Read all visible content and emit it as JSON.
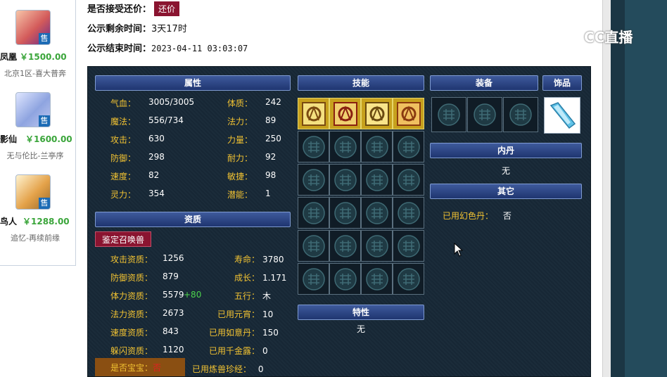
{
  "sidebar": {
    "pets": [
      {
        "name": "凤凰",
        "price": "￥1500.00",
        "server": "北京1区-喜大普奔",
        "sold_label": "售"
      },
      {
        "name": "影仙",
        "price": "￥1600.00",
        "server": "无与伦比-兰亭序",
        "sold_label": "售"
      },
      {
        "name": "鸟人",
        "price": "￥1288.00",
        "server": "追忆-再续前缘",
        "sold_label": "售"
      }
    ]
  },
  "listing": {
    "bargain_label": "是否接受还价：",
    "bargain_button": "还价",
    "remaining_label": "公示剩余时间：",
    "remaining_value": "3天17时",
    "end_label": "公示结束时间：",
    "end_value": "2023-04-11 03:03:07"
  },
  "watermark": {
    "text": "CC直播"
  },
  "attributes": {
    "header": "属性",
    "left": [
      {
        "k": "气血：",
        "v": "3005/3005"
      },
      {
        "k": "魔法：",
        "v": "556/734"
      },
      {
        "k": "攻击：",
        "v": "630"
      },
      {
        "k": "防御：",
        "v": "298"
      },
      {
        "k": "速度：",
        "v": "82"
      },
      {
        "k": "灵力：",
        "v": "354"
      }
    ],
    "right": [
      {
        "k": "体质：",
        "v": "242"
      },
      {
        "k": "法力：",
        "v": "89"
      },
      {
        "k": "力量：",
        "v": "250"
      },
      {
        "k": "耐力：",
        "v": "92"
      },
      {
        "k": "敏捷：",
        "v": "98"
      },
      {
        "k": "潜能：",
        "v": "1"
      }
    ]
  },
  "aptitude": {
    "header": "资质",
    "appraise_button": "鉴定召唤兽",
    "left": [
      {
        "k": "攻击资质：",
        "v": "1256",
        "plus": ""
      },
      {
        "k": "防御资质：",
        "v": "879",
        "plus": ""
      },
      {
        "k": "体力资质：",
        "v": "5579",
        "plus": "+80"
      },
      {
        "k": "法力资质：",
        "v": "2673",
        "plus": ""
      },
      {
        "k": "速度资质：",
        "v": "843",
        "plus": ""
      },
      {
        "k": "躲闪资质：",
        "v": "1120",
        "plus": ""
      }
    ],
    "right": [
      {
        "k": "寿命：",
        "v": "3780"
      },
      {
        "k": "成长：",
        "v": "1.171"
      },
      {
        "k": "五行：",
        "v": "木"
      },
      {
        "k": "已用元宵：",
        "v": "10"
      },
      {
        "k": "已用如意丹：",
        "v": "150"
      },
      {
        "k": "已用千金露：",
        "v": "0"
      }
    ],
    "baby_label": "是否宝宝：",
    "baby_value": "否",
    "beast_book_label": "已用炼兽珍经：",
    "beast_book_value": "0"
  },
  "skills": {
    "header": "技能",
    "filled": [
      "skill-1",
      "skill-2",
      "skill-3",
      "skill-4"
    ]
  },
  "traits": {
    "header": "特性",
    "value": "无"
  },
  "equipment": {
    "header": "装备",
    "ornament_header": "饰品"
  },
  "inner": {
    "header": "内丹",
    "value": "无"
  },
  "other": {
    "header": "其它",
    "items": [
      {
        "k": "已用幻色丹：",
        "v": "否"
      }
    ]
  },
  "colors": {
    "accent_red": "#8a1430",
    "label_gold": "#f1c232",
    "price_green": "#3aa53a"
  }
}
